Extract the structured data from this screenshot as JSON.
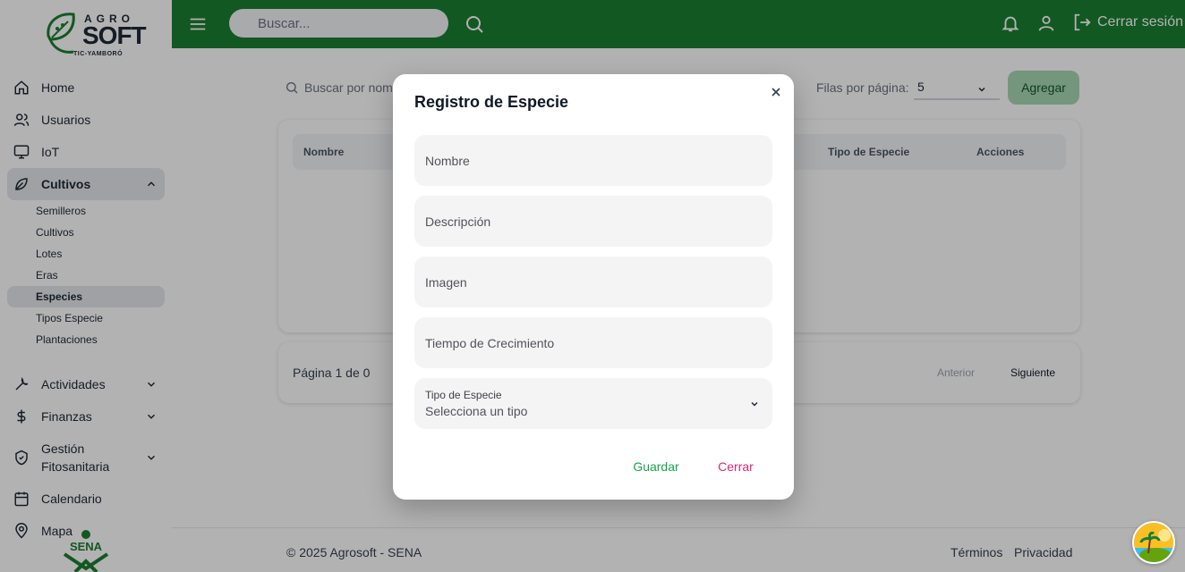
{
  "brand": {
    "line1": "AGRO",
    "line2": "SOFT",
    "line3": "TIC-YAMBORÓ",
    "seal": "SENA"
  },
  "colors": {
    "topbar": "#1b7f31",
    "accent_green": "#16a34a",
    "close_pink": "#db2777"
  },
  "sidebar": {
    "items": [
      {
        "label": "Home",
        "icon": "home-icon"
      },
      {
        "label": "Usuarios",
        "icon": "users-icon"
      },
      {
        "label": "IoT",
        "icon": "monitor-icon"
      },
      {
        "label": "Cultivos",
        "icon": "leaf-icon"
      },
      {
        "label": "Actividades",
        "icon": "wrench-icon"
      },
      {
        "label": "Finanzas",
        "icon": "dollar-icon"
      },
      {
        "label": "Gestión Fitosanitaria",
        "icon": "shield-icon"
      },
      {
        "label": "Calendario",
        "icon": "calendar-icon"
      },
      {
        "label": "Mapa",
        "icon": "map-pin-icon"
      }
    ],
    "cultivos_sub": [
      "Semilleros",
      "Cultivos",
      "Lotes",
      "Eras",
      "Especies",
      "Tipos Especie",
      "Plantaciones"
    ]
  },
  "topbar": {
    "search_placeholder": "Buscar...",
    "logout_label": "Cerrar sesión"
  },
  "main": {
    "search_placeholder": "Buscar por nombre...",
    "rows_label": "Filas por página:",
    "rows_value": "5",
    "add_label": "Agregar",
    "columns": [
      "Nombre",
      "Tipo de Especie",
      "Acciones"
    ],
    "page_info": "Página 1 de 0",
    "prev_label": "Anterior",
    "next_label": "Siguiente"
  },
  "footer": {
    "copyright": "© 2025 Agrosoft - SENA",
    "terms": "Términos",
    "privacy": "Privacidad"
  },
  "modal": {
    "title": "Registro de Especie",
    "fields": [
      "Nombre",
      "Descripción",
      "Imagen",
      "Tiempo de Crecimiento"
    ],
    "select_label": "Tipo de Especie",
    "select_value": "Selecciona un tipo",
    "save_label": "Guardar",
    "close_label": "Cerrar"
  }
}
